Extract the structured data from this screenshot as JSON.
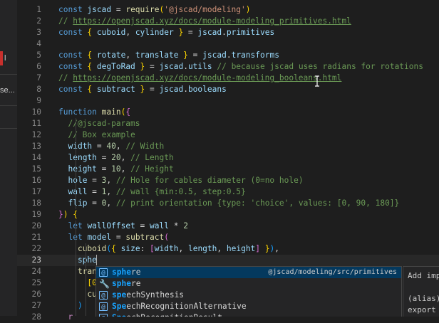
{
  "sidebar": {
    "frag_a": "l",
    "frag_b": "se..."
  },
  "editor": {
    "current_line": 23,
    "lines": [
      {
        "n": "1",
        "t": [
          [
            "kw",
            "const "
          ],
          [
            "var",
            "jscad"
          ],
          [
            "pn",
            " = "
          ],
          [
            "fn",
            "require"
          ],
          [
            "br1",
            "("
          ],
          [
            "str",
            "'@jscad/modeling'"
          ],
          [
            "br1",
            ")"
          ]
        ]
      },
      {
        "n": "2",
        "t": [
          [
            "cm",
            "// "
          ],
          [
            "link",
            "https://openjscad.xyz/docs/module-modeling_primitives.html"
          ]
        ]
      },
      {
        "n": "3",
        "t": [
          [
            "kw",
            "const "
          ],
          [
            "br1",
            "{ "
          ],
          [
            "var",
            "cuboid"
          ],
          [
            "pn",
            ", "
          ],
          [
            "var",
            "cylinder"
          ],
          [
            "br1",
            " }"
          ],
          [
            "pn",
            " = "
          ],
          [
            "var",
            "jscad"
          ],
          [
            "pn",
            "."
          ],
          [
            "var",
            "primitives"
          ]
        ]
      },
      {
        "n": "4",
        "t": []
      },
      {
        "n": "5",
        "t": [
          [
            "kw",
            "const "
          ],
          [
            "br1",
            "{ "
          ],
          [
            "var",
            "rotate"
          ],
          [
            "pn",
            ", "
          ],
          [
            "var",
            "translate"
          ],
          [
            "br1",
            " }"
          ],
          [
            "pn",
            " = "
          ],
          [
            "var",
            "jscad"
          ],
          [
            "pn",
            "."
          ],
          [
            "var",
            "transforms"
          ]
        ]
      },
      {
        "n": "6",
        "t": [
          [
            "kw",
            "const "
          ],
          [
            "br1",
            "{ "
          ],
          [
            "var",
            "degToRad"
          ],
          [
            "br1",
            " }"
          ],
          [
            "pn",
            " = "
          ],
          [
            "var",
            "jscad"
          ],
          [
            "pn",
            "."
          ],
          [
            "var",
            "utils"
          ],
          [
            "cm",
            " // because jscad uses radians for rotations"
          ]
        ]
      },
      {
        "n": "7",
        "t": [
          [
            "cm",
            "// "
          ],
          [
            "link",
            "https://openjscad.xyz/docs/module-modeling_booleans.html"
          ]
        ]
      },
      {
        "n": "8",
        "t": [
          [
            "kw",
            "const "
          ],
          [
            "br1",
            "{ "
          ],
          [
            "var",
            "subtract"
          ],
          [
            "br1",
            " }"
          ],
          [
            "pn",
            " = "
          ],
          [
            "var",
            "jscad"
          ],
          [
            "pn",
            "."
          ],
          [
            "var",
            "booleans"
          ]
        ]
      },
      {
        "n": "9",
        "t": []
      },
      {
        "n": "10",
        "t": [
          [
            "kw",
            "function "
          ],
          [
            "fn",
            "main"
          ],
          [
            "br1",
            "("
          ],
          [
            "br2",
            "{"
          ]
        ]
      },
      {
        "n": "11",
        "t": [
          [
            "cm",
            "  //@jscad-params"
          ]
        ]
      },
      {
        "n": "12",
        "t": [
          [
            "cm",
            "  // Box example"
          ]
        ]
      },
      {
        "n": "13",
        "t": [
          [
            "pn",
            "  "
          ],
          [
            "var",
            "width"
          ],
          [
            "pn",
            " = "
          ],
          [
            "num",
            "40"
          ],
          [
            "pn",
            ","
          ],
          [
            "cm",
            " // Width"
          ]
        ]
      },
      {
        "n": "14",
        "t": [
          [
            "pn",
            "  "
          ],
          [
            "var",
            "length"
          ],
          [
            "pn",
            " = "
          ],
          [
            "num",
            "20"
          ],
          [
            "pn",
            ","
          ],
          [
            "cm",
            " // Length"
          ]
        ]
      },
      {
        "n": "15",
        "t": [
          [
            "pn",
            "  "
          ],
          [
            "var",
            "height"
          ],
          [
            "pn",
            " = "
          ],
          [
            "num",
            "10"
          ],
          [
            "pn",
            ","
          ],
          [
            "cm",
            " // Height"
          ]
        ]
      },
      {
        "n": "16",
        "t": [
          [
            "pn",
            "  "
          ],
          [
            "var",
            "hole"
          ],
          [
            "pn",
            " = "
          ],
          [
            "num",
            "3"
          ],
          [
            "pn",
            ","
          ],
          [
            "cm",
            " // Hole for cables diameter (0=no hole)"
          ]
        ]
      },
      {
        "n": "17",
        "t": [
          [
            "pn",
            "  "
          ],
          [
            "var",
            "wall"
          ],
          [
            "pn",
            " = "
          ],
          [
            "num",
            "1"
          ],
          [
            "pn",
            ","
          ],
          [
            "cm",
            " // wall {min:0.5, step:0.5}"
          ]
        ]
      },
      {
        "n": "18",
        "t": [
          [
            "pn",
            "  "
          ],
          [
            "var",
            "flip"
          ],
          [
            "pn",
            " = "
          ],
          [
            "num",
            "0"
          ],
          [
            "pn",
            ","
          ],
          [
            "cm",
            " // print orientation {type: 'choice', values: [0, 90, 180]}"
          ]
        ]
      },
      {
        "n": "19",
        "t": [
          [
            "br2",
            "}"
          ],
          [
            "br1",
            ")"
          ],
          [
            "pn",
            " "
          ],
          [
            "br1",
            "{"
          ]
        ]
      },
      {
        "n": "20",
        "t": [
          [
            "pn",
            "  "
          ],
          [
            "kw",
            "let "
          ],
          [
            "var",
            "wallOffset"
          ],
          [
            "pn",
            " = "
          ],
          [
            "var",
            "wall"
          ],
          [
            "pn",
            " * "
          ],
          [
            "num",
            "2"
          ]
        ]
      },
      {
        "n": "21",
        "t": [
          [
            "pn",
            "  "
          ],
          [
            "kw",
            "let "
          ],
          [
            "var",
            "model"
          ],
          [
            "pn",
            " = "
          ],
          [
            "fn",
            "subtract"
          ],
          [
            "br2",
            "("
          ]
        ]
      },
      {
        "n": "22",
        "t": [
          [
            "pn",
            "    "
          ],
          [
            "fn",
            "cuboid"
          ],
          [
            "br3",
            "("
          ],
          [
            "br1",
            "{ "
          ],
          [
            "var",
            "size"
          ],
          [
            "pn",
            ": "
          ],
          [
            "br2",
            "["
          ],
          [
            "var",
            "width"
          ],
          [
            "pn",
            ", "
          ],
          [
            "var",
            "length"
          ],
          [
            "pn",
            ", "
          ],
          [
            "var",
            "height"
          ],
          [
            "br2",
            "]"
          ],
          [
            "br1",
            " }"
          ],
          [
            "br3",
            ")"
          ],
          [
            "pn",
            ","
          ]
        ]
      },
      {
        "n": "23",
        "t": [
          [
            "pn",
            "    "
          ],
          [
            "var",
            "sphe"
          ]
        ]
      },
      {
        "n": "24",
        "t": [
          [
            "pn",
            "    "
          ],
          [
            "fn",
            "tran"
          ]
        ]
      },
      {
        "n": "25",
        "t": [
          [
            "pn",
            "      "
          ],
          [
            "br1",
            "[0"
          ]
        ]
      },
      {
        "n": "26",
        "t": [
          [
            "pn",
            "      "
          ],
          [
            "fn",
            "cu"
          ]
        ]
      },
      {
        "n": "27",
        "t": [
          [
            "pn",
            "    "
          ],
          [
            "br3",
            ")"
          ]
        ]
      },
      {
        "n": "28",
        "t": [
          [
            "pn",
            "  "
          ],
          [
            "ctl",
            "r"
          ]
        ]
      }
    ]
  },
  "suggest": {
    "items": [
      {
        "icon": "variable-icon",
        "glyph": "[@]",
        "match": "sphe",
        "rest": "re",
        "detail": "@jscad/modeling/src/primitives"
      },
      {
        "icon": "wrench-icon",
        "glyph": "🔧",
        "match": "sphe",
        "rest": "re",
        "detail": ""
      },
      {
        "icon": "variable-icon",
        "glyph": "[@]",
        "match": "spe",
        "rest": "echSynthesis",
        "detail": ""
      },
      {
        "icon": "variable-icon",
        "glyph": "[@]",
        "match": "Spe",
        "rest": "echRecognitionAlternative",
        "detail": ""
      },
      {
        "icon": "variable-icon",
        "glyph": "[@]",
        "match": "Spe",
        "rest": "echRecognitionResult",
        "detail": ""
      }
    ]
  },
  "docs": {
    "line1": "Add imp",
    "line2": "(alias)",
    "line3": "export"
  }
}
